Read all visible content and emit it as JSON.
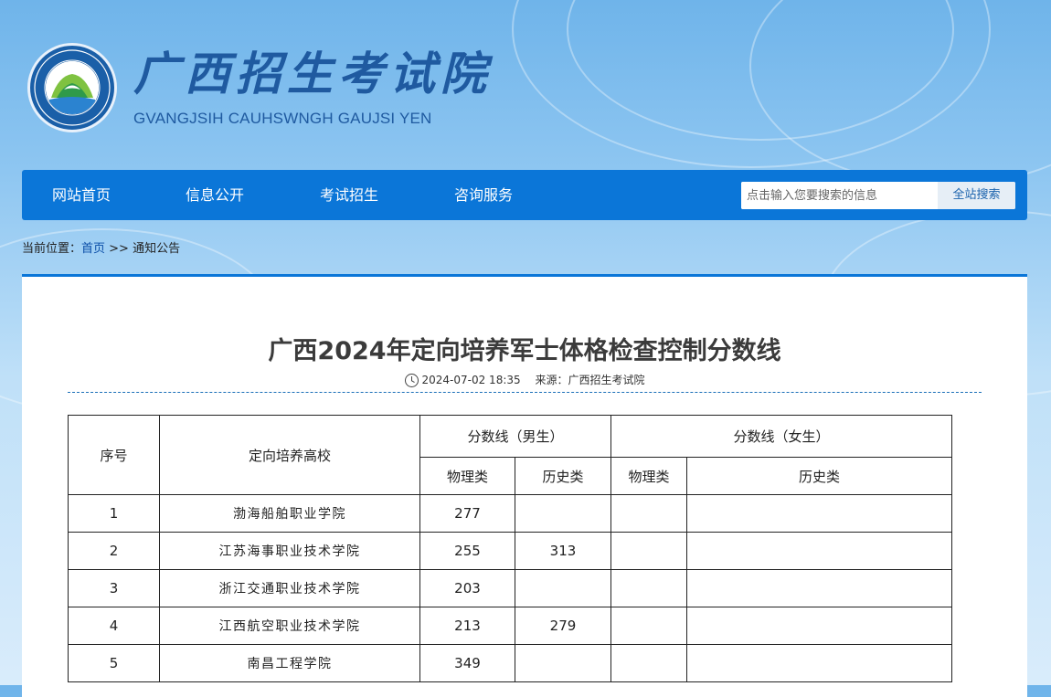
{
  "header": {
    "logo_cn": "广西招生考试院",
    "logo_en": "GVANGJSIH CAUHSWNGH GAUJSI YEN",
    "emblem_ring_text": "GVANGJSIH CAUHSWNGH GAUJSI YEN"
  },
  "nav": {
    "items": [
      {
        "label": "网站首页"
      },
      {
        "label": "信息公开"
      },
      {
        "label": "考试招生"
      },
      {
        "label": "咨询服务"
      }
    ],
    "search_placeholder": "点击输入您要搜索的信息",
    "search_button": "全站搜索"
  },
  "breadcrumb": {
    "prefix": "当前位置：",
    "home": "首页",
    "separator": " >> ",
    "current": "通知公告"
  },
  "article": {
    "title": "广西2024年定向培养军士体格检查控制分数线",
    "date": "2024-07-02 18:35",
    "source_label": "来源：",
    "source": "广西招生考试院"
  },
  "table": {
    "headers": {
      "index": "序号",
      "school": "定向培养高校",
      "male_group": "分数线（男生）",
      "female_group": "分数线（女生）",
      "physics": "物理类",
      "history": "历史类"
    },
    "rows": [
      {
        "no": "1",
        "school": "渤海船舶职业学院",
        "male_physics": "277",
        "male_history": "",
        "female_physics": "",
        "female_history": ""
      },
      {
        "no": "2",
        "school": "江苏海事职业技术学院",
        "male_physics": "255",
        "male_history": "313",
        "female_physics": "",
        "female_history": ""
      },
      {
        "no": "3",
        "school": "浙江交通职业技术学院",
        "male_physics": "203",
        "male_history": "",
        "female_physics": "",
        "female_history": ""
      },
      {
        "no": "4",
        "school": "江西航空职业技术学院",
        "male_physics": "213",
        "male_history": "279",
        "female_physics": "",
        "female_history": ""
      },
      {
        "no": "5",
        "school": "南昌工程学院",
        "male_physics": "349",
        "male_history": "",
        "female_physics": "",
        "female_history": ""
      }
    ]
  }
}
